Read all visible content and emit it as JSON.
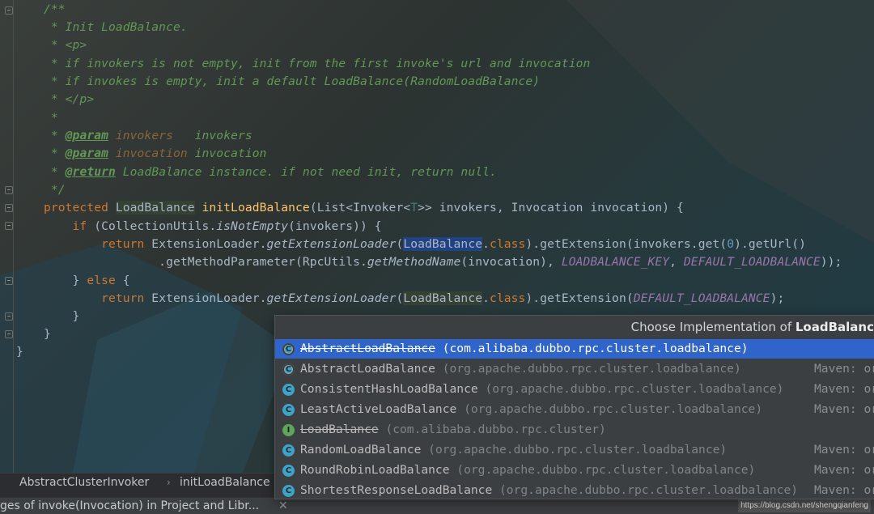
{
  "editor": {
    "lines": [
      {
        "segments": [
          {
            "t": "/**",
            "c": "cm"
          }
        ]
      },
      {
        "segments": [
          {
            "t": " * Init LoadBalance.",
            "c": "cm"
          }
        ]
      },
      {
        "segments": [
          {
            "t": " * <p>",
            "c": "cm"
          }
        ]
      },
      {
        "segments": [
          {
            "t": " * if invokers is not empty, init from the first invoke's url and invocation",
            "c": "cm"
          }
        ]
      },
      {
        "segments": [
          {
            "t": " * if invokes is empty, init a default LoadBalance(RandomLoadBalance)",
            "c": "cm"
          }
        ]
      },
      {
        "segments": [
          {
            "t": " * </p>",
            "c": "cm"
          }
        ]
      },
      {
        "segments": [
          {
            "t": " *",
            "c": "cm"
          }
        ]
      },
      {
        "segments": [
          {
            "t": " * ",
            "c": "cm"
          },
          {
            "t": "@param",
            "c": "tag"
          },
          {
            "t": " invokers",
            "c": "pname"
          },
          {
            "t": "   invokers",
            "c": "cm"
          }
        ]
      },
      {
        "segments": [
          {
            "t": " * ",
            "c": "cm"
          },
          {
            "t": "@param",
            "c": "tag"
          },
          {
            "t": " invocation",
            "c": "pname"
          },
          {
            "t": " invocation",
            "c": "cm"
          }
        ]
      },
      {
        "segments": [
          {
            "t": " * ",
            "c": "cm"
          },
          {
            "t": "@return",
            "c": "tag"
          },
          {
            "t": " LoadBalance instance. if not need init, return null.",
            "c": "cm"
          }
        ]
      },
      {
        "segments": [
          {
            "t": " */",
            "c": "cm"
          }
        ]
      },
      {
        "segments": [
          {
            "t": "protected ",
            "c": "kw"
          },
          {
            "t": "LoadBalance",
            "c": "hl-green"
          },
          {
            "t": " "
          },
          {
            "t": "initLoadBalance",
            "c": "fn"
          },
          {
            "t": "(List<Invoker<"
          },
          {
            "t": "T",
            "c": "tp"
          },
          {
            "t": ">> invokers, Invocation invocation) {"
          }
        ]
      },
      {
        "segments": [
          {
            "t": "    "
          },
          {
            "t": "if",
            "c": "kw"
          },
          {
            "t": " (CollectionUtils."
          },
          {
            "t": "isNotEmpty",
            "c": "it"
          },
          {
            "t": "(invokers)) {"
          }
        ]
      },
      {
        "segments": [
          {
            "t": "        "
          },
          {
            "t": "return",
            "c": "kw"
          },
          {
            "t": " ExtensionLoader."
          },
          {
            "t": "getExtensionLoader",
            "c": "it"
          },
          {
            "t": "("
          },
          {
            "t": "LoadBalance",
            "c": "hl-blue"
          },
          {
            "t": ".",
            "c": ""
          },
          {
            "t": "class",
            "c": "kw"
          },
          {
            "t": ").getExtension(invokers.get("
          },
          {
            "t": "0",
            "c": "num"
          },
          {
            "t": ").getUrl()"
          }
        ]
      },
      {
        "segments": [
          {
            "t": "                .getMethodParameter(RpcUtils."
          },
          {
            "t": "getMethodName",
            "c": "it"
          },
          {
            "t": "(invocation), "
          },
          {
            "t": "LOADBALANCE_KEY",
            "c": "cst"
          },
          {
            "t": ", "
          },
          {
            "t": "DEFAULT_LOADBALANCE",
            "c": "cst"
          },
          {
            "t": "));"
          }
        ]
      },
      {
        "segments": [
          {
            "t": "    } "
          },
          {
            "t": "else",
            "c": "kw"
          },
          {
            "t": " {"
          }
        ]
      },
      {
        "segments": [
          {
            "t": "        "
          },
          {
            "t": "return",
            "c": "kw"
          },
          {
            "t": " ExtensionLoader."
          },
          {
            "t": "getExtensionLoader",
            "c": "it"
          },
          {
            "t": "("
          },
          {
            "t": "LoadBalance",
            "c": "hl-green"
          },
          {
            "t": "."
          },
          {
            "t": "class",
            "c": "kw"
          },
          {
            "t": ").getExtension("
          },
          {
            "t": "DEFAULT_LOADBALANCE",
            "c": "cst"
          },
          {
            "t": ");"
          }
        ]
      },
      {
        "segments": [
          {
            "t": "    }"
          }
        ]
      },
      {
        "segments": [
          {
            "t": "}"
          }
        ]
      },
      {
        "segments": [
          {
            "t": "}"
          }
        ]
      }
    ]
  },
  "popup": {
    "title_prefix": "Choose Implementation of ",
    "title_class": "LoadBalanc",
    "items": [
      {
        "icon": "C",
        "icon_name": "abstract-class-icon",
        "name": "AbstractLoadBalance",
        "pkg": " (com.alibaba.dubbo.rpc.cluster.loadbalance)",
        "strike": true,
        "selected": true,
        "source": ""
      },
      {
        "icon": "C",
        "icon_name": "abstract-class-icon",
        "name": "AbstractLoadBalance",
        "pkg": " (org.apache.dubbo.rpc.cluster.loadbalance)",
        "strike": false,
        "selected": false,
        "source": "Maven: or"
      },
      {
        "icon": "C",
        "icon_name": "class-icon",
        "name": "ConsistentHashLoadBalance",
        "pkg": " (org.apache.dubbo.rpc.cluster.loadbalance)",
        "strike": false,
        "selected": false,
        "source": "Maven: or"
      },
      {
        "icon": "C",
        "icon_name": "class-icon",
        "name": "LeastActiveLoadBalance",
        "pkg": " (org.apache.dubbo.rpc.cluster.loadbalance)",
        "strike": false,
        "selected": false,
        "source": "Maven: or"
      },
      {
        "icon": "I",
        "icon_name": "interface-icon",
        "name": "LoadBalance",
        "pkg": " (com.alibaba.dubbo.rpc.cluster)",
        "strike": true,
        "selected": false,
        "source": ""
      },
      {
        "icon": "C",
        "icon_name": "class-icon",
        "name": "RandomLoadBalance",
        "pkg": " (org.apache.dubbo.rpc.cluster.loadbalance)",
        "strike": false,
        "selected": false,
        "source": "Maven: or"
      },
      {
        "icon": "C",
        "icon_name": "class-icon",
        "name": "RoundRobinLoadBalance",
        "pkg": " (org.apache.dubbo.rpc.cluster.loadbalance)",
        "strike": false,
        "selected": false,
        "source": "Maven: or"
      },
      {
        "icon": "C",
        "icon_name": "class-icon",
        "name": "ShortestResponseLoadBalance",
        "pkg": " (org.apache.dubbo.rpc.cluster.loadbalance)",
        "strike": false,
        "selected": false,
        "source": "Maven: or"
      }
    ]
  },
  "breadcrumb": {
    "class_name": "AbstractClusterInvoker",
    "separator": "›",
    "method_name": "initLoadBalance"
  },
  "status_bar": {
    "text": "ges of invoke(Invocation) in Project and Libr...",
    "close": "✕"
  },
  "watermark": "https://blog.csdn.net/shengqianfeng"
}
